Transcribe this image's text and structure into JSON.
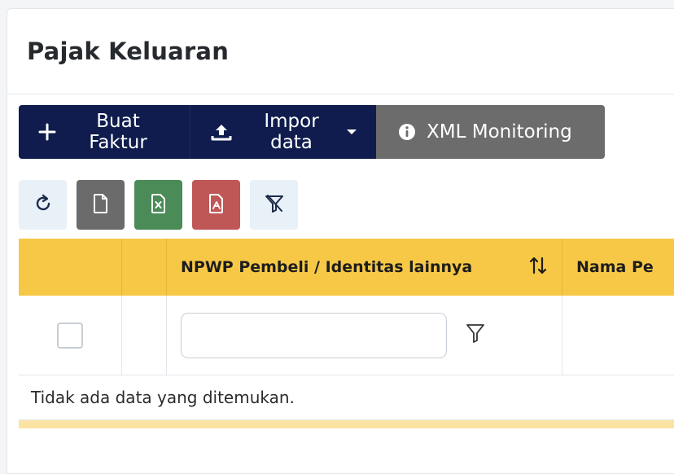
{
  "page": {
    "title": "Pajak Keluaran"
  },
  "actions": {
    "create_label": "Buat Faktur",
    "import_label": "Impor data",
    "xml_label": "XML Monitoring"
  },
  "toolbar": {
    "refresh_icon": "refresh-icon",
    "file_icon": "file-icon",
    "excel_icon": "excel-file-icon",
    "pdf_icon": "pdf-file-icon",
    "clear_filter_icon": "clear-filter-icon"
  },
  "table": {
    "columns": [
      "",
      "",
      "NPWP Pembeli / Identitas lainnya",
      "Nama Pe"
    ],
    "filter_value": "",
    "empty_message": "Tidak ada data yang ditemukan."
  },
  "colors": {
    "primary": "#0f1c4d",
    "secondary": "#6c6c6c",
    "header_yellow": "#f7c846",
    "excel_green": "#4a8b57",
    "pdf_red": "#c05757"
  }
}
